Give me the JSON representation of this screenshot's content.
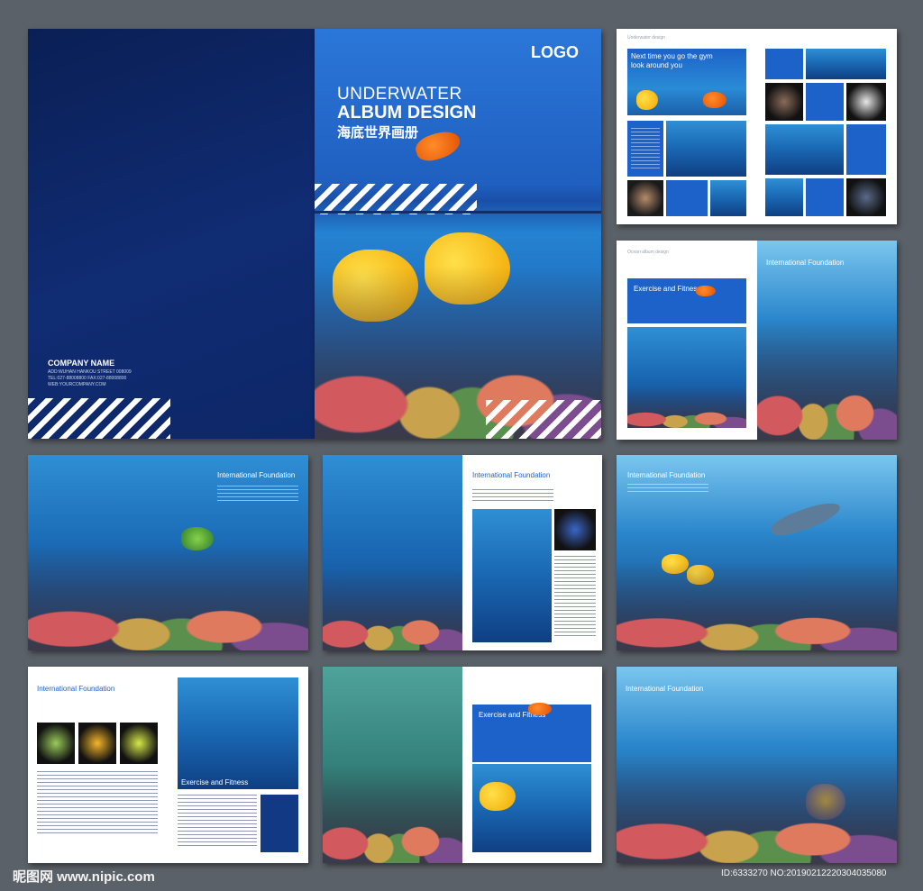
{
  "cover": {
    "logo": "LOGO",
    "title_line1": "UNDERWATER",
    "title_line2": "ALBUM DESIGN",
    "title_cn": "海底世界画册",
    "company_name": "COMPANY NAME",
    "address_line": "ADD:WUHAN HANKOU STREET 008009",
    "tel_line": "TEL:027-88008800 FAX:027-88008800",
    "web_line": "WEB:YOURCOMPANY.COM"
  },
  "spread_right1": {
    "small_label": "Underwater design",
    "headline_line1": "Next time you go the gym",
    "headline_line2": "look around you"
  },
  "spread_right2": {
    "small_label": "Ocean album design",
    "left_heading": "Exercise and Fitness",
    "right_heading": "International Foundation"
  },
  "row2": {
    "heading_a": "International Foundation",
    "heading_b": "International Foundation",
    "heading_c": "International Foundation"
  },
  "row3": {
    "heading_a": "International Foundation",
    "sub_heading_a": "Exercise and Fitness",
    "heading_b": "Exercise and Fitness",
    "heading_c": "International Foundation"
  },
  "watermark": {
    "site": "昵图网 www.nipic.com",
    "id_text": "ID:6333270 NO:20190212220304035080"
  }
}
